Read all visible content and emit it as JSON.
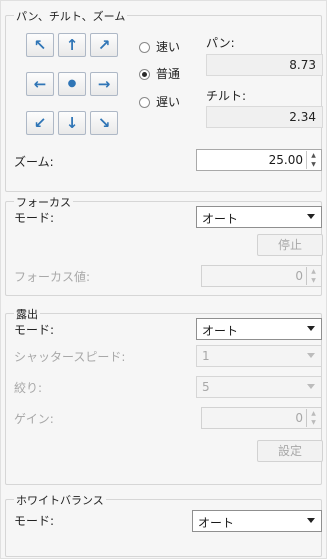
{
  "pan_tilt_zoom": {
    "title": "パン、チルト、ズーム",
    "buttons": [
      "↖",
      "↑",
      "↗",
      "←",
      "●",
      "→",
      "↙",
      "↓",
      "↘"
    ],
    "speed": {
      "options": [
        "速い",
        "普通",
        "遅い"
      ],
      "selected": "普通"
    },
    "pan_label": "パン:",
    "pan_value": "8.73",
    "tilt_label": "チルト:",
    "tilt_value": "2.34",
    "zoom_label": "ズーム:",
    "zoom_value": "25.00"
  },
  "focus": {
    "title": "フォーカス",
    "mode_label": "モード:",
    "mode_value": "オート",
    "stop_button": "停止",
    "focus_value_label": "フォーカス値:",
    "focus_value": "0"
  },
  "exposure": {
    "title": "露出",
    "mode_label": "モード:",
    "mode_value": "オート",
    "shutter_label": "シャッタースピード:",
    "shutter_value": "1",
    "iris_label": "絞り:",
    "iris_value": "5",
    "gain_label": "ゲイン:",
    "gain_value": "0",
    "set_button": "設定"
  },
  "white_balance": {
    "title": "ホワイトバランス",
    "mode_label": "モード:",
    "mode_value": "オート"
  },
  "colors": {
    "arrow_blue": "#2f75b6",
    "disabled_text": "#a8a8a8"
  }
}
